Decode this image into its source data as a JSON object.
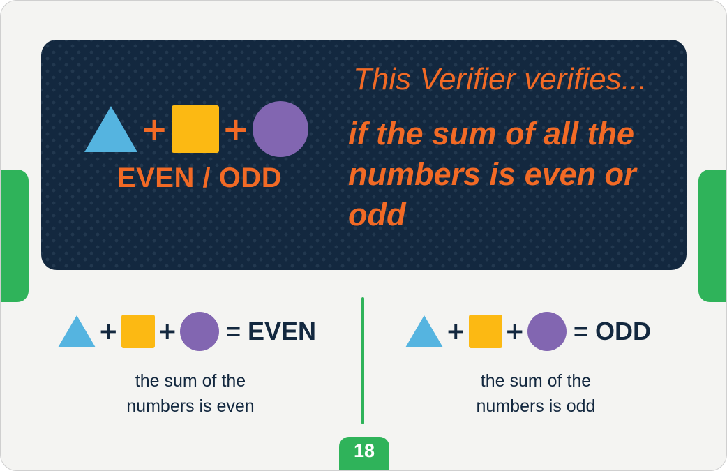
{
  "header": {
    "formula_operator": "+",
    "label": "EVEN / ODD",
    "intro": "This Verifier verifies...",
    "criterion": "if the sum of all the numbers is even or odd"
  },
  "results": [
    {
      "operator": "+",
      "equation_text": "= EVEN",
      "description_line1": "the sum of the",
      "description_line2": "numbers is even"
    },
    {
      "operator": "+",
      "equation_text": "= ODD",
      "description_line1": "the sum of the",
      "description_line2": "numbers is odd"
    }
  ],
  "page_number": "18",
  "colors": {
    "panel": "#13283f",
    "orange": "#f26a25",
    "triangle": "#55b4e0",
    "square": "#fcb913",
    "circle": "#8266b1",
    "green": "#2fb35a"
  },
  "icons": {
    "triangle": "blue-triangle-icon",
    "square": "yellow-square-icon",
    "circle": "purple-circle-icon"
  }
}
